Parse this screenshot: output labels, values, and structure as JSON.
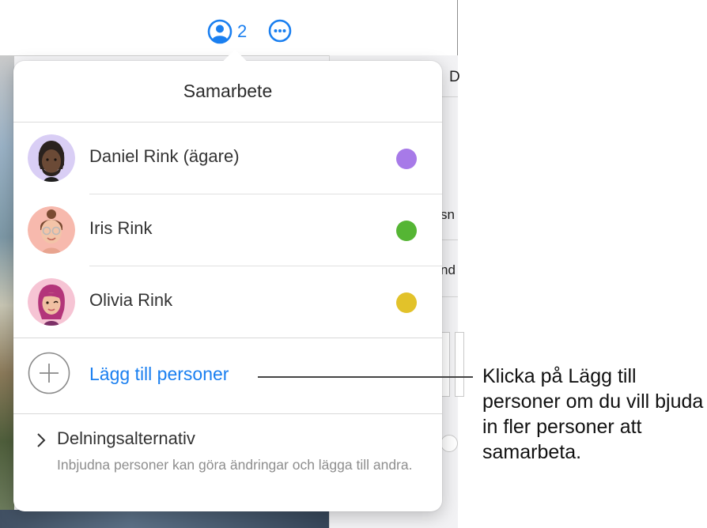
{
  "toolbar": {
    "collaborator_count": "2",
    "collaborate_icon": "person-circle-icon",
    "more_icon": "ellipsis-circle-icon",
    "accent_color": "#1a7ff0"
  },
  "background_panel": {
    "fragments": [
      "D",
      "sn",
      "nd"
    ]
  },
  "popover": {
    "title": "Samarbete",
    "participants": [
      {
        "name": "Daniel Rink (ägare)",
        "color": "#a77ae8",
        "avatar": "memoji-man-dreadlocks"
      },
      {
        "name": "Iris Rink",
        "color": "#55b534",
        "avatar": "memoji-woman-glasses-bun"
      },
      {
        "name": "Olivia Rink",
        "color": "#e2c22a",
        "avatar": "memoji-girl-pink-hair-wink"
      }
    ],
    "add_people": {
      "label": "Lägg till personer",
      "icon": "plus-circle-icon"
    },
    "sharing_options": {
      "title": "Delningsalternativ",
      "description": "Inbjudna personer kan göra ändringar och lägga till andra.",
      "icon": "chevron-right-icon"
    }
  },
  "callout": {
    "text": "Klicka på Lägg till personer om du vill bjuda in fler personer att samarbeta."
  }
}
